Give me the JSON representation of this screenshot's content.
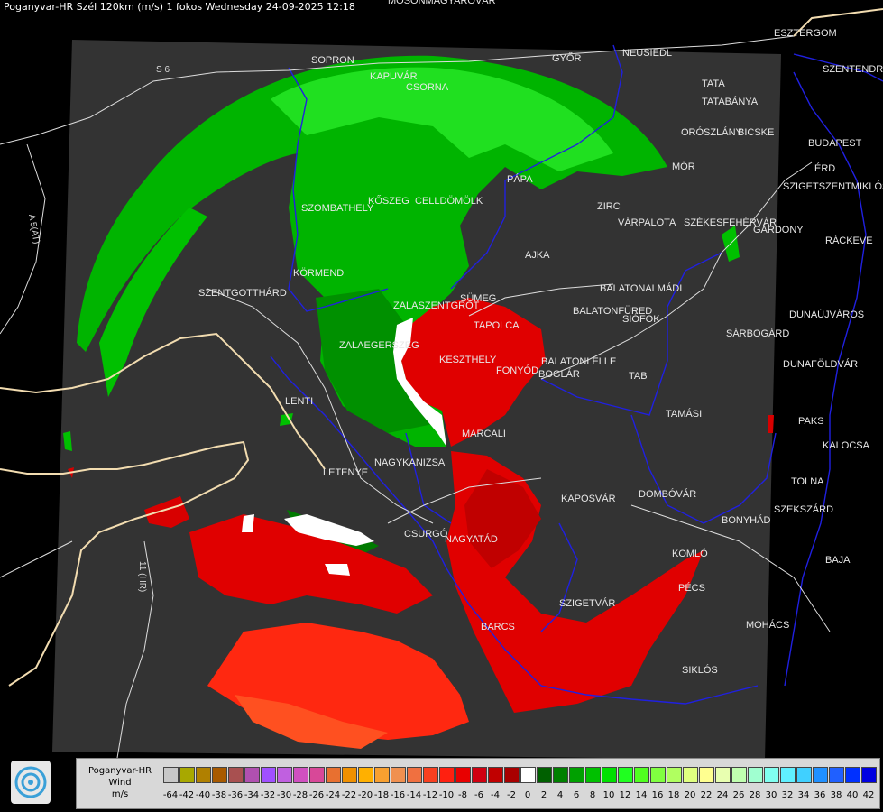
{
  "title": "Poganyvar-HR Szél 120km (m/s) 1 fokos Wednesday 24-09-2025 12:18",
  "logo_icon": "weather-service-logo-icon",
  "legend": {
    "label_lines": [
      "Poganyvar-HR",
      "Wind",
      "m/s"
    ],
    "colors": [
      "#c8c8c8",
      "#a8a800",
      "#b08000",
      "#a85a00",
      "#a85050",
      "#b050b0",
      "#a050ff",
      "#c060e0",
      "#d050c0",
      "#d84898",
      "#e87030",
      "#f09000",
      "#ffb000",
      "#f8a030",
      "#f09050",
      "#f07040",
      "#f84020",
      "#ff2010",
      "#e80000",
      "#d00010",
      "#c00000",
      "#a80000",
      "#ffffff",
      "#006000",
      "#008000",
      "#00a000",
      "#00c000",
      "#00e000",
      "#20ff20",
      "#50ff20",
      "#80ff40",
      "#b0ff60",
      "#e0ff80",
      "#ffff90",
      "#e8ffb0",
      "#c0ffb0",
      "#a0ffd0",
      "#80fff0",
      "#60f0ff",
      "#40d0ff",
      "#2090ff",
      "#2060ff",
      "#0030ff",
      "#0000e0"
    ],
    "ticks": [
      "-64",
      "-42",
      "-40",
      "-38",
      "-36",
      "-34",
      "-32",
      "-30",
      "-28",
      "-26",
      "-24",
      "-22",
      "-20",
      "-18",
      "-16",
      "-14",
      "-12",
      "-10",
      "-8",
      "-6",
      "-4",
      "-2",
      "0",
      "2",
      "4",
      "6",
      "8",
      "10",
      "12",
      "14",
      "16",
      "18",
      "20",
      "22",
      "24",
      "26",
      "28",
      "30",
      "32",
      "34",
      "36",
      "38",
      "40",
      "42"
    ]
  },
  "road_labels": [
    "S 6",
    "A 5(AT)",
    "11 (HR)"
  ],
  "cities": [
    "MOSONMAGYARÓVÁR",
    "GYŐR",
    "NEUSIEDL",
    "ESZTERGOM",
    "SOPRON",
    "KAPUVÁR",
    "CSORNA",
    "TATA",
    "TATABÁNYA",
    "PÁPA",
    "BICSKE",
    "ORÓSZLÁNY",
    "SZENTENDRE",
    "MÓR",
    "BUDAPEST",
    "ÉRD",
    "SZIGETSZENTMIKLÓS",
    "ZIRC",
    "SZÉKESFEHÉRVÁR",
    "VÁRPALOTA",
    "GÁRDONY",
    "KŐSZEG",
    "SZOMBATHELY",
    "CELLDÖMÖLK",
    "AJKA",
    "RÁCKEVE",
    "KÖRMEND",
    "SZENTGOTTHÁRD",
    "SÜMEG",
    "BALATONALMÁDI",
    "ZALASZENTGRÓT",
    "BALATONFÜRED",
    "SIÓFOK",
    "DUNAÚJVÁROS",
    "TAPOLCA",
    "ZALAEGERSZEG",
    "SÁRBOGÁRD",
    "KESZTHELY",
    "BALATONLELLE",
    "FONYÓD",
    "BOGLÁR",
    "DUNAFÖLDVÁR",
    "TAB",
    "LENTI",
    "TAMÁSI",
    "PAKS",
    "MARCALI",
    "KALOCSA",
    "LETENYE",
    "NAGYKANIZSA",
    "TOLNA",
    "KAPOSVÁR",
    "DOMBÓVÁR",
    "SZEKSZÁRD",
    "CSURGÓ",
    "BONYHÁD",
    "NAGYATÁD",
    "KOMLÓ",
    "BAJA",
    "PÉCS",
    "SZIGETVÁR",
    "BARCS",
    "MOHÁCS",
    "SIKLÓS"
  ]
}
